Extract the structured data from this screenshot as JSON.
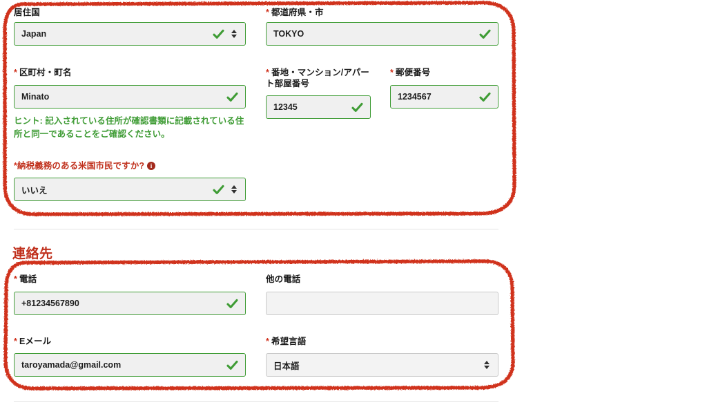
{
  "address_section": {
    "fields": [
      {
        "name": "country-of-residence",
        "label": "居住国",
        "required": false,
        "value": "Japan",
        "kind": "select",
        "valid": true
      },
      {
        "name": "state-province-city",
        "label": "都道府県・市",
        "required": true,
        "value": "TOKYO",
        "kind": "text",
        "valid": true
      },
      {
        "name": "ward-town",
        "label": "区町村・町名",
        "required": true,
        "value": "Minato",
        "kind": "text",
        "valid": true
      },
      {
        "name": "street-apartment-number",
        "label": "番地・マンション/アパート部屋番号",
        "required": true,
        "value": "12345",
        "kind": "text",
        "valid": true
      },
      {
        "name": "postal-code",
        "label": "郵便番号",
        "required": true,
        "value": "1234567",
        "kind": "text",
        "valid": true
      },
      {
        "name": "us-taxpayer-question",
        "label": "納税義務のある米国市民ですか?",
        "required": true,
        "value": "いいえ",
        "kind": "select",
        "valid": true,
        "info_icon": "info-icon",
        "info_glyph": "i"
      }
    ],
    "hint": "ヒント: 記入されている住所が確認書類に記載されている住所と同一であることをご確認ください。"
  },
  "contact_section": {
    "heading": "連絡先",
    "fields": [
      {
        "name": "phone",
        "label": "電話",
        "required": true,
        "value": "+81234567890",
        "kind": "text",
        "valid": true
      },
      {
        "name": "other-phone",
        "label": "他の電話",
        "required": false,
        "value": "",
        "kind": "text",
        "valid": false
      },
      {
        "name": "email",
        "label": "Eメール",
        "required": true,
        "value": "taroyamada@gmail.com",
        "kind": "text",
        "valid": true
      },
      {
        "name": "preferred-language",
        "label": "希望言語",
        "required": true,
        "value": "日本語",
        "kind": "select",
        "valid": false
      }
    ]
  },
  "markers": {
    "required_asterisk": "*",
    "valid_check": "check-icon"
  },
  "colors": {
    "annotation_red": "#d0321e",
    "valid_green": "#3f9c35",
    "hint_green": "#3f9c35",
    "heading_red": "#c0301c",
    "field_bg": "#f0f0f0",
    "neutral_border": "#c9c9c9"
  },
  "annotations": [
    {
      "name": "address-block-highlight",
      "shape": "rounded-rectangle",
      "color": "#d0321e"
    },
    {
      "name": "contact-block-highlight",
      "shape": "rounded-rectangle",
      "color": "#d0321e"
    }
  ]
}
